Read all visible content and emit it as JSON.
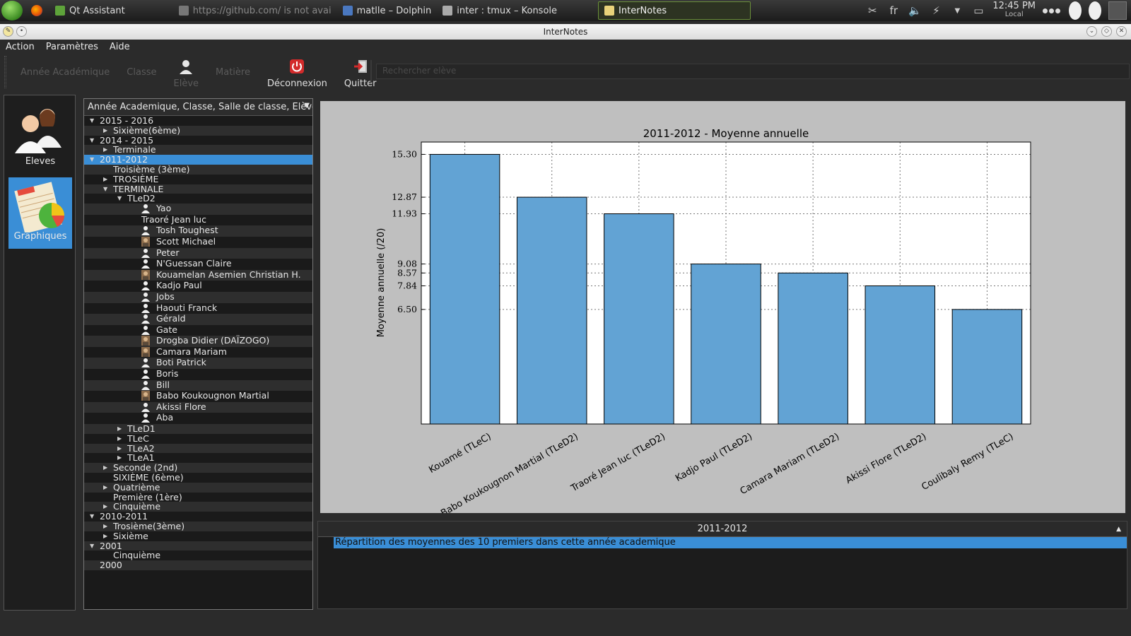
{
  "taskbar": {
    "tasks": [
      {
        "label": "Qt Assistant",
        "state": "normal"
      },
      {
        "label": "https://github.com/ is not avai",
        "state": "dim"
      },
      {
        "label": "matlle – Dolphin",
        "state": "normal"
      },
      {
        "label": "inter : tmux – Konsole",
        "state": "normal"
      },
      {
        "label": "InterNotes",
        "state": "active"
      }
    ],
    "tray": {
      "lang": "fr",
      "time": "12:45 PM",
      "zone": "Local"
    }
  },
  "window": {
    "title": "InterNotes"
  },
  "menu": {
    "items": [
      "Action",
      "Paramètres",
      "Aide"
    ]
  },
  "toolbar": {
    "annee": "Année Académique",
    "classe": "Classe",
    "eleve": "Elève",
    "matiere": "Matière",
    "deconnexion": "Déconnexion",
    "quitter": "Quitter",
    "search_placeholder": "Rechercher elève"
  },
  "leftpanel": {
    "eleves": "Eleves",
    "graphiques": "Graphiques"
  },
  "tree": {
    "header": "Année Academique, Classe, Salle de classe, Elève",
    "rows": [
      {
        "label": "2015 - 2016",
        "level": 0,
        "twisty": "open"
      },
      {
        "label": "Sixième(6ème)",
        "level": 1,
        "twisty": "closed"
      },
      {
        "label": "2014 - 2015",
        "level": 0,
        "twisty": "open"
      },
      {
        "label": "Terminale",
        "level": 1,
        "twisty": "closed"
      },
      {
        "label": "2011-2012",
        "level": 0,
        "twisty": "open",
        "selected": true
      },
      {
        "label": "Troisième  (3ème)",
        "level": 1,
        "twisty": "none"
      },
      {
        "label": "TROSIÈME",
        "level": 1,
        "twisty": "closed"
      },
      {
        "label": "TERMINALE",
        "level": 1,
        "twisty": "open"
      },
      {
        "label": "TLeD2",
        "level": 2,
        "twisty": "open"
      },
      {
        "label": "Yao",
        "level": 3,
        "icon": "user"
      },
      {
        "label": "Traoré Jean luc",
        "level": 3,
        "icon": "none"
      },
      {
        "label": "Tosh Toughest",
        "level": 3,
        "icon": "user"
      },
      {
        "label": "Scott Michael",
        "level": 3,
        "icon": "photo"
      },
      {
        "label": "Peter",
        "level": 3,
        "icon": "user"
      },
      {
        "label": "N'Guessan Claire",
        "level": 3,
        "icon": "user"
      },
      {
        "label": "Kouamelan Asemien Christian H.",
        "level": 3,
        "icon": "photo"
      },
      {
        "label": "Kadjo Paul",
        "level": 3,
        "icon": "user"
      },
      {
        "label": "Jobs",
        "level": 3,
        "icon": "user"
      },
      {
        "label": "Haouti Franck",
        "level": 3,
        "icon": "user"
      },
      {
        "label": "Gérald",
        "level": 3,
        "icon": "user"
      },
      {
        "label": "Gate",
        "level": 3,
        "icon": "user"
      },
      {
        "label": "Drogba Didier (DAÏZOGO)",
        "level": 3,
        "icon": "photo"
      },
      {
        "label": "Camara Mariam",
        "level": 3,
        "icon": "photo"
      },
      {
        "label": "Boti Patrick",
        "level": 3,
        "icon": "user"
      },
      {
        "label": "Boris",
        "level": 3,
        "icon": "user"
      },
      {
        "label": "Bill",
        "level": 3,
        "icon": "user"
      },
      {
        "label": "Babo Koukougnon Martial",
        "level": 3,
        "icon": "photo"
      },
      {
        "label": "Akissi Flore",
        "level": 3,
        "icon": "user"
      },
      {
        "label": "Aba",
        "level": 3,
        "icon": "user"
      },
      {
        "label": "TLeD1",
        "level": 2,
        "twisty": "closed"
      },
      {
        "label": "TLeC",
        "level": 2,
        "twisty": "closed"
      },
      {
        "label": "TLeA2",
        "level": 2,
        "twisty": "closed"
      },
      {
        "label": "TLeA1",
        "level": 2,
        "twisty": "closed"
      },
      {
        "label": "Seconde (2nd)",
        "level": 1,
        "twisty": "closed"
      },
      {
        "label": "SIXIÈME (6ème)",
        "level": 1,
        "twisty": "none"
      },
      {
        "label": "Quatrième",
        "level": 1,
        "twisty": "closed"
      },
      {
        "label": "Première (1ère)",
        "level": 1,
        "twisty": "none"
      },
      {
        "label": "Cinquième",
        "level": 1,
        "twisty": "closed"
      },
      {
        "label": "2010-2011",
        "level": 0,
        "twisty": "open"
      },
      {
        "label": "Trosième(3ème)",
        "level": 1,
        "twisty": "closed"
      },
      {
        "label": "Sixième",
        "level": 1,
        "twisty": "closed"
      },
      {
        "label": "2001",
        "level": 0,
        "twisty": "open"
      },
      {
        "label": "Cinquième",
        "level": 1,
        "twisty": "none"
      },
      {
        "label": "2000",
        "level": 0,
        "twisty": "none"
      }
    ]
  },
  "chart_data": {
    "type": "bar",
    "title": "2011-2012 - Moyenne annuelle",
    "ylabel": "Moyenne annuelle (/20)",
    "xlabel": "",
    "categories": [
      "Kouamé  (TLeC)",
      "Babo Koukougnon Martial (TLeD2)",
      "Traoré Jean luc (TLeD2)",
      "Kadjo Paul (TLeD2)",
      "Camara Mariam (TLeD2)",
      "Akissi Flore (TLeD2)",
      "Coulibaly Remy (TLeC)"
    ],
    "values": [
      15.3,
      12.87,
      11.93,
      9.08,
      8.57,
      7.84,
      6.5
    ],
    "yticks": [
      "15.30",
      "12.87",
      "11.93",
      "9.08",
      "8.57",
      "7.84",
      "6.50"
    ],
    "ylim": [
      0,
      16
    ],
    "grid": true,
    "bar_color": "#62a3d4"
  },
  "bottom": {
    "combo_value": "2011-2012",
    "list_item": "Répartition des moyennes des 10 premiers dans cette année academique"
  }
}
